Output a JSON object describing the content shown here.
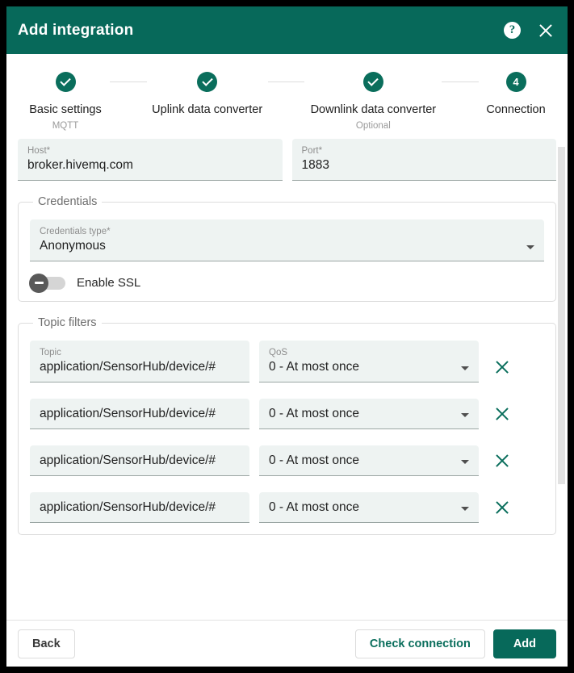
{
  "window": {
    "title": "Add integration",
    "help_icon": "help-circle-icon",
    "close_icon": "close-icon",
    "accent_green": "#07695a",
    "field_bg": "#eef3f2"
  },
  "stepper": {
    "steps": [
      {
        "marker": "check",
        "label": "Basic settings",
        "sub": "MQTT"
      },
      {
        "marker": "check",
        "label": "Uplink data converter",
        "sub": ""
      },
      {
        "marker": "check",
        "label": "Downlink data converter",
        "sub": "Optional"
      },
      {
        "marker": "4",
        "label": "Connection",
        "sub": ""
      }
    ]
  },
  "connection": {
    "host": {
      "label": "Host*",
      "value": "broker.hivemq.com",
      "placeholder": "Host*"
    },
    "port": {
      "label": "Port*",
      "value": "1883",
      "placeholder": "Port*"
    }
  },
  "credentials": {
    "legend": "Credentials",
    "type": {
      "label": "Credentials type*",
      "value": "Anonymous"
    },
    "ssl": {
      "label": "Enable SSL",
      "checked": false
    }
  },
  "topic_filters": {
    "legend": "Topic filters",
    "topic_label": "Topic",
    "qos_label": "QoS",
    "rows": [
      {
        "topic": "application/SensorHub/device/#",
        "qos": "0 - At most once"
      },
      {
        "topic": "application/SensorHub/device/#",
        "qos": "0 - At most once"
      },
      {
        "topic": "application/SensorHub/device/#",
        "qos": "0 - At most once"
      },
      {
        "topic": "application/SensorHub/device/#",
        "qos": "0 - At most once"
      }
    ],
    "delete_icon": "close-icon"
  },
  "footer": {
    "back": "Back",
    "check_connection": "Check connection",
    "add": "Add"
  }
}
